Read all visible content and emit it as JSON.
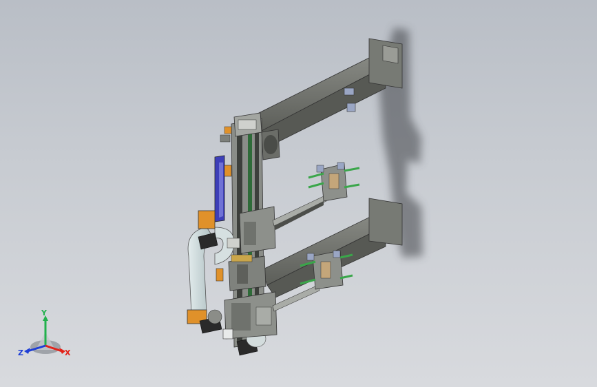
{
  "viewport": {
    "background_top": "#b9bec6",
    "background_bottom": "#d8dade"
  },
  "triad": {
    "x_label": "X",
    "y_label": "Y",
    "z_label": "Z",
    "x_color": "#e2231a",
    "y_color": "#22b14c",
    "z_color": "#1f3fd6"
  },
  "model": {
    "frame_color": "#6b6d68",
    "rail_color": "#8a8d88",
    "cable_color": "#c9d8da",
    "bracket_color": "#e0912a",
    "guide_color": "#3d3fb8",
    "motor_color": "#2a2a2a",
    "accent_color": "#3aa64a"
  }
}
